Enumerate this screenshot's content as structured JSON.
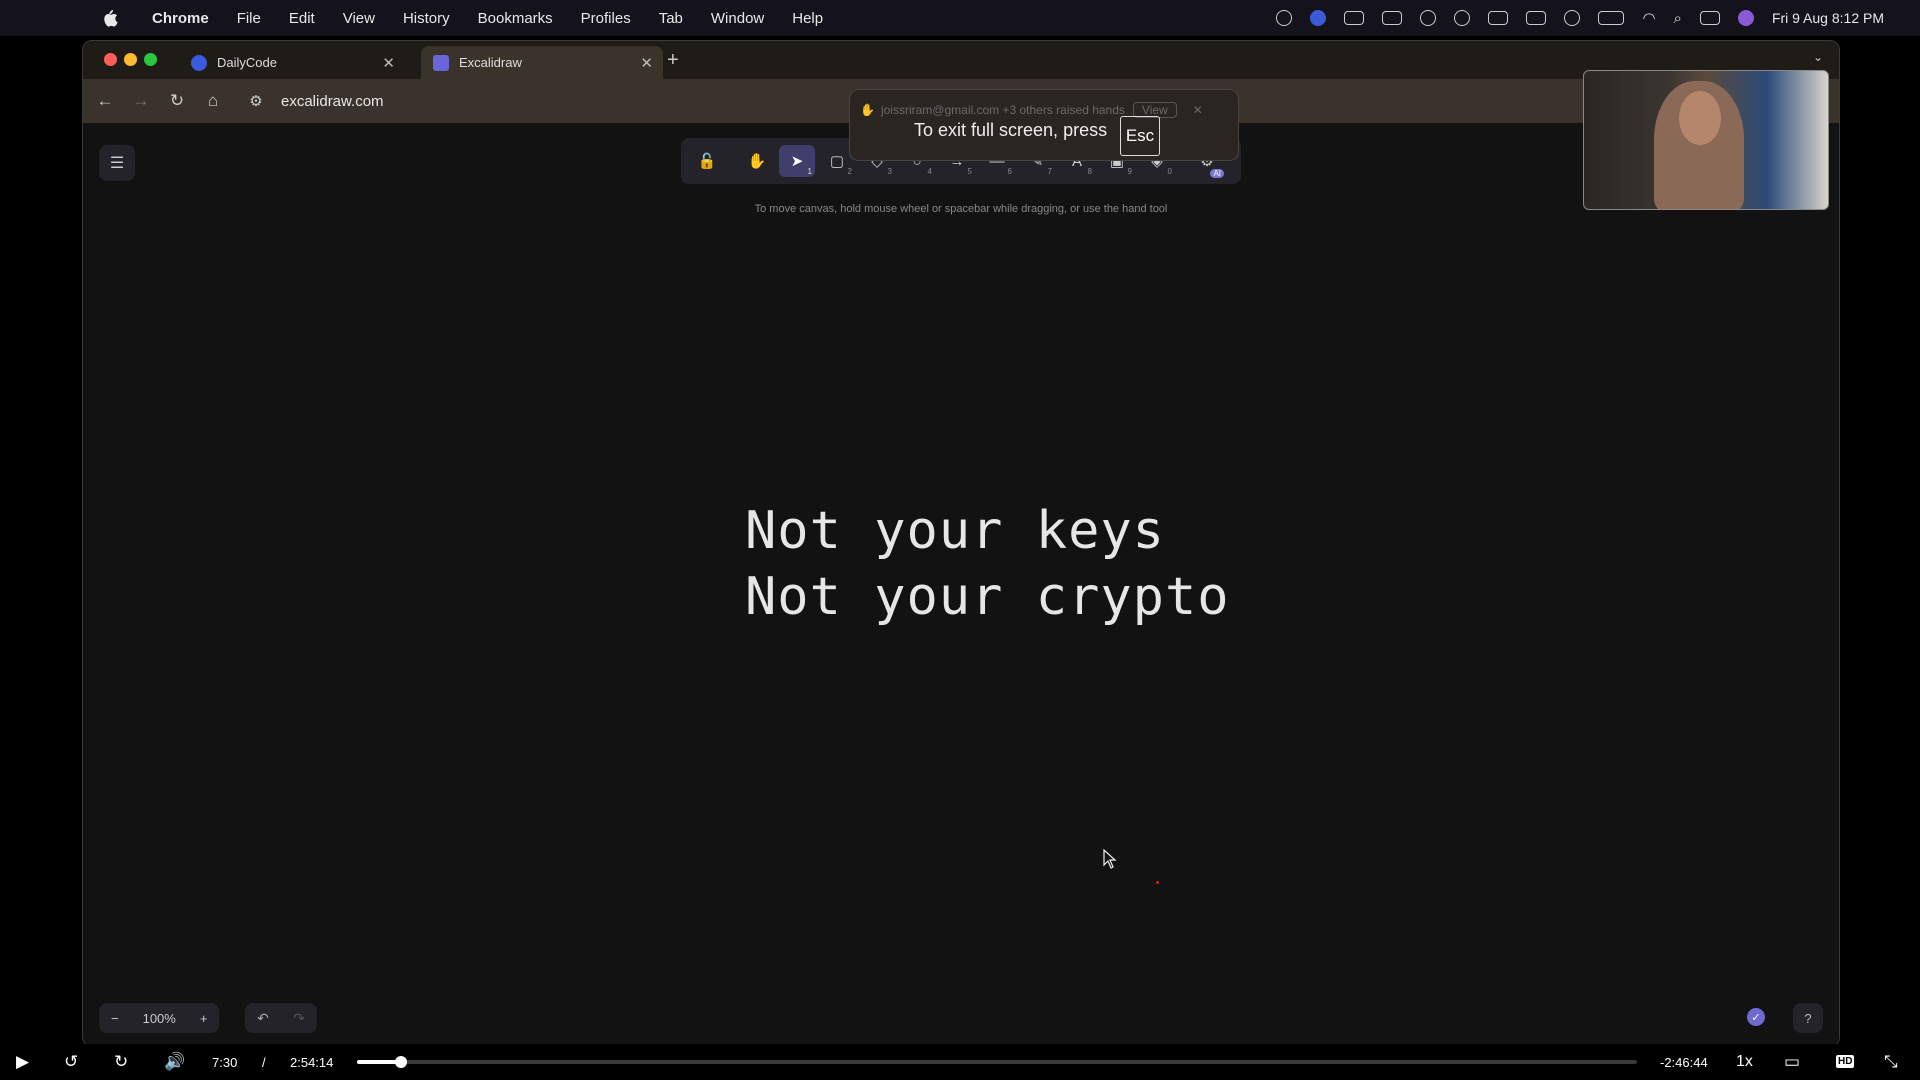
{
  "menubar": {
    "app": "Chrome",
    "items": [
      "File",
      "Edit",
      "View",
      "History",
      "Bookmarks",
      "Profiles",
      "Tab",
      "Window",
      "Help"
    ],
    "clock": "Fri 9 Aug  8:12 PM"
  },
  "browser": {
    "tabs": [
      {
        "title": "DailyCode",
        "active": false
      },
      {
        "title": "Excalidraw",
        "active": true
      }
    ],
    "new_tab": "+",
    "url": "excalidraw.com"
  },
  "fullscreen_popup": {
    "notification": "joissriram@gmail.com +3 others raised hands",
    "notification_action": "View",
    "message": "To exit full screen, press",
    "key": "Esc"
  },
  "excalidraw": {
    "tools": [
      {
        "name": "lock",
        "glyph": "🔓",
        "num": ""
      },
      {
        "name": "hand",
        "glyph": "✋",
        "num": ""
      },
      {
        "name": "selection",
        "glyph": "➤",
        "num": "1"
      },
      {
        "name": "rectangle",
        "glyph": "▢",
        "num": "2"
      },
      {
        "name": "diamond",
        "glyph": "◇",
        "num": "3"
      },
      {
        "name": "ellipse",
        "glyph": "○",
        "num": "4"
      },
      {
        "name": "arrow",
        "glyph": "→",
        "num": "5"
      },
      {
        "name": "line",
        "glyph": "—",
        "num": "6"
      },
      {
        "name": "draw",
        "glyph": "✎",
        "num": "7"
      },
      {
        "name": "text",
        "glyph": "A",
        "num": "8"
      },
      {
        "name": "image",
        "glyph": "▣",
        "num": "9"
      },
      {
        "name": "eraser",
        "glyph": "◈",
        "num": "0"
      },
      {
        "name": "more-tools",
        "glyph": "⚙",
        "num": "",
        "badge": "AI"
      }
    ],
    "active_tool": "selection",
    "hint": "To move canvas, hold mouse wheel or spacebar while dragging, or use the hand tool",
    "canvas_text": [
      "Not your keys",
      "Not your crypto"
    ],
    "zoom": "100%"
  },
  "player": {
    "current_time": "7:30",
    "separator": "/",
    "duration": "2:54:14",
    "remaining": "-2:46:44",
    "speed": "1x",
    "hd": "HD",
    "progress": 0.0346
  }
}
